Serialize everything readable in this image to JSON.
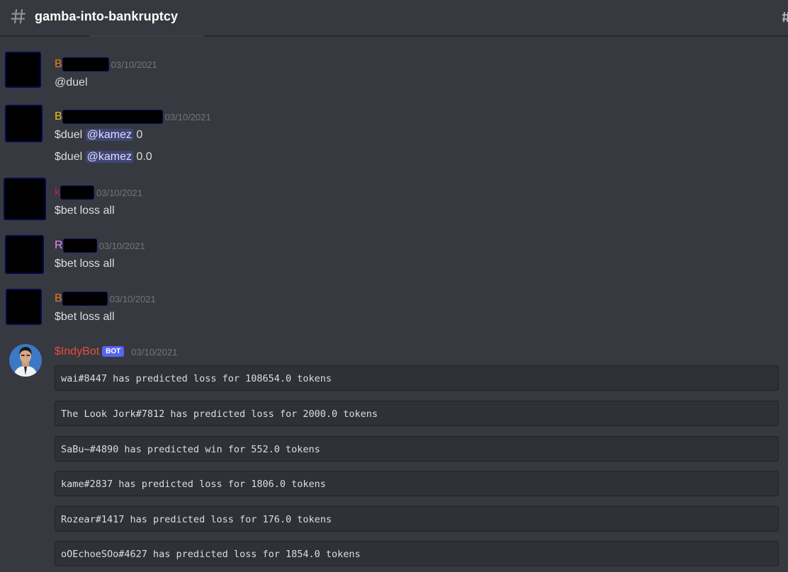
{
  "header": {
    "channel_icon": "hash-icon",
    "channel_name": "gamba-into-bankruptcy"
  },
  "colors": {
    "background": "#36393f",
    "embed_background": "#2f3136",
    "mention_text": "#dee0fc",
    "bot_badge": "#5865f2",
    "timestamp": "#72767d"
  },
  "messages": [
    {
      "user_initial": "B",
      "user_color": "#e67e22",
      "timestamp": "03/10/2021",
      "lines": [
        "@duel"
      ]
    },
    {
      "user_initial": "B",
      "user_color": "#f1c40f",
      "timestamp": "03/10/2021",
      "lines": [
        {
          "prefix": "$duel ",
          "mention": "@kamez",
          "suffix": " 0"
        },
        {
          "prefix": "$duel ",
          "mention": "@kamez",
          "suffix": " 0.0"
        }
      ]
    },
    {
      "user_initial": "k",
      "user_color": "#c2185b",
      "timestamp": "03/10/2021",
      "lines": [
        "$bet loss all"
      ]
    },
    {
      "user_initial": "R",
      "user_color": "#f47fff",
      "timestamp": "03/10/2021",
      "lines": [
        "$bet loss all"
      ]
    },
    {
      "user_initial": "B",
      "user_color": "#e67e22",
      "timestamp": "03/10/2021",
      "lines": [
        "$bet loss all"
      ]
    }
  ],
  "bot_message": {
    "username": "$IndyBot",
    "user_color": "#e74c3c",
    "badge": "BOT",
    "timestamp": "03/10/2021",
    "embeds": [
      "wai#8447 has predicted loss for 108654.0 tokens",
      "The Look Jork#7812 has predicted loss for 2000.0 tokens",
      "SaBu~#4890 has predicted win for 552.0 tokens",
      "kame#2837 has predicted loss for 1806.0 tokens",
      "Rozear#1417 has predicted loss for 176.0 tokens",
      "oOEchoeSOo#4627 has predicted loss for 1854.0 tokens"
    ]
  }
}
